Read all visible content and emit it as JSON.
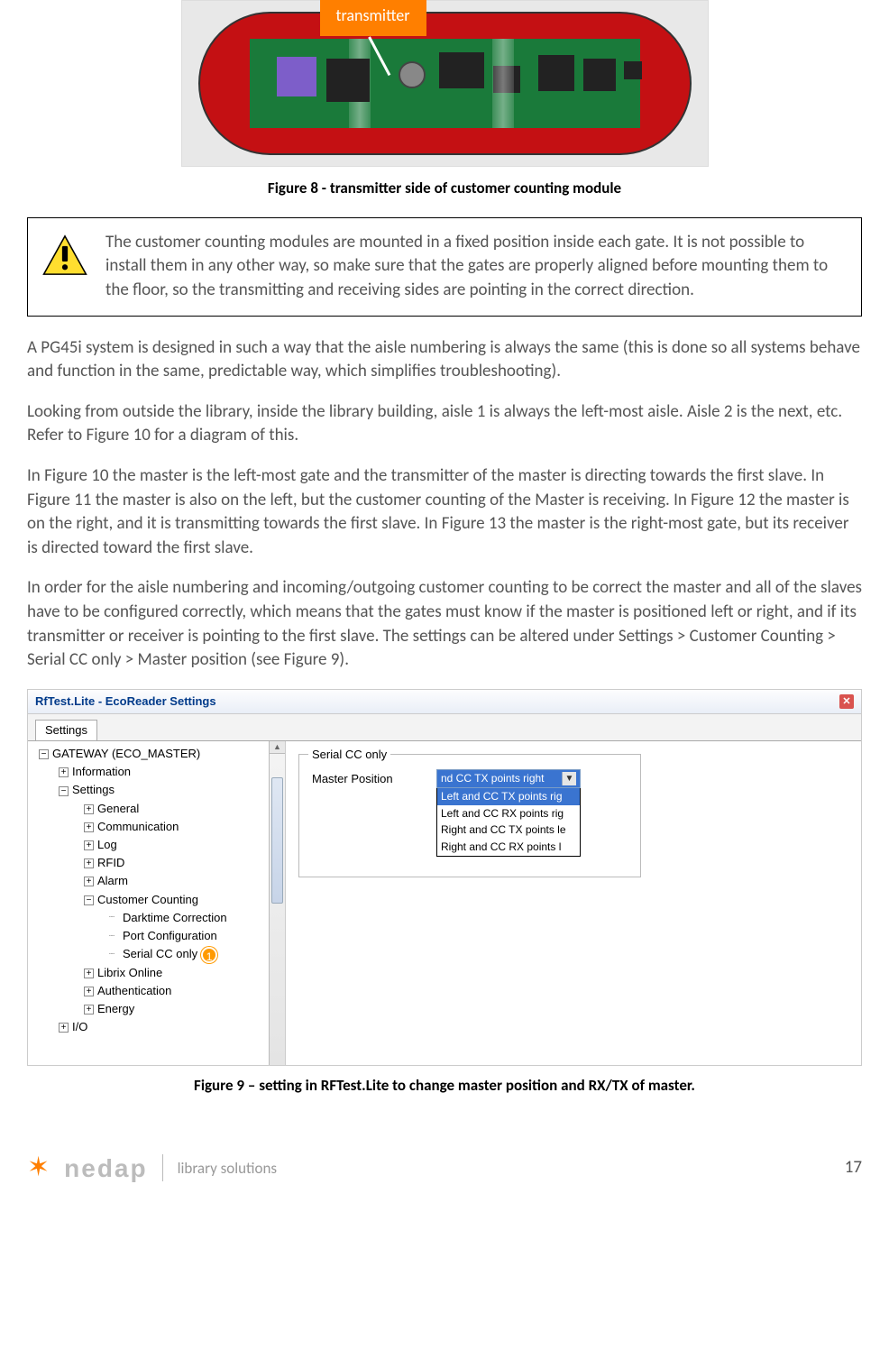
{
  "figure8": {
    "callout": "transmitter",
    "caption": "Figure 8 - transmitter side of customer counting module"
  },
  "warning": {
    "text": "The customer counting modules are mounted in a fixed position inside each gate. It is not possible to install them in any other way, so make sure that the gates are properly aligned before mounting them to the floor, so the transmitting and receiving sides are pointing in the correct direction."
  },
  "paragraphs": {
    "p1": "A PG45i system is designed in such a way that the aisle numbering is always the same (this is done so all systems behave and function in the same, predictable way, which simplifies troubleshooting).",
    "p2": "Looking from outside the library, inside the library building, aisle 1 is always the left-most aisle. Aisle 2 is the next, etc. Refer to Figure 10 for a diagram of this.",
    "p3": "In Figure 10 the master is the left-most gate and the transmitter of the master is directing towards the first slave. In Figure 11 the master is also on the left, but the customer counting  of the Master is receiving. In Figure 12 the master is on the right, and it is transmitting towards the first slave. In Figure 13 the master is the right-most gate, but its receiver is directed toward the first slave.",
    "p4": "In order for the aisle numbering and incoming/outgoing customer counting to be correct the master and all of the slaves have to be configured correctly, which means that the gates must know if the master is positioned left or right, and if its transmitter or receiver is pointing to the first slave. The settings can be altered under Settings > Customer Counting > Serial CC only > Master position (see Figure 9)."
  },
  "rftest": {
    "windowTitle": "RfTest.Lite - EcoReader Settings",
    "tab": "Settings",
    "tree": {
      "root": "GATEWAY (ECO_MASTER)",
      "n_info": "Information",
      "n_settings": "Settings",
      "n_general": "General",
      "n_comm": "Communication",
      "n_log": "Log",
      "n_rfid": "RFID",
      "n_alarm": "Alarm",
      "n_cc": "Customer Counting",
      "n_dark": "Darktime Correction",
      "n_port": "Port Configuration",
      "n_serial": "Serial CC only",
      "n_librix": "Librix Online",
      "n_auth": "Authentication",
      "n_energy": "Energy",
      "n_io": "I/O"
    },
    "badge": "1",
    "group": {
      "title": "Serial CC only",
      "label": "Master Position",
      "selected": "nd CC TX points right",
      "options": {
        "o1": "Left and CC TX points rig",
        "o2": "Left and CC RX points rig",
        "o3": "Right and CC TX points le",
        "o4": "Right and CC RX points l"
      }
    }
  },
  "figure9": {
    "caption": "Figure 9 – setting in RFTest.Lite to change master position and RX/TX of master."
  },
  "footer": {
    "brand": "nedap",
    "tagline": "library solutions",
    "page": "17"
  }
}
